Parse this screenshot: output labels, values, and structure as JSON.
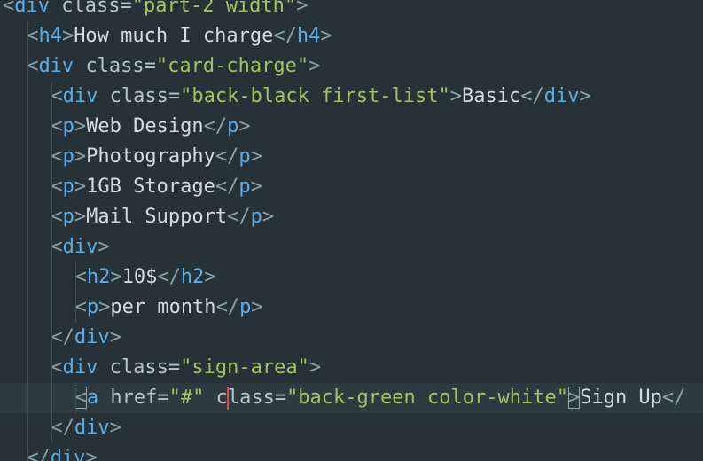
{
  "editor": {
    "lines": [
      {
        "indent": 0,
        "tokens": [
          {
            "t": "<",
            "c": "bracket"
          },
          {
            "t": "div",
            "c": "tag"
          },
          {
            "t": " ",
            "c": "text"
          },
          {
            "t": "class",
            "c": "attr"
          },
          {
            "t": "=",
            "c": "eq"
          },
          {
            "t": "\"part-2 width\"",
            "c": "str"
          },
          {
            "t": ">",
            "c": "bracket"
          }
        ]
      },
      {
        "indent": 1,
        "tokens": [
          {
            "t": "<",
            "c": "bracket"
          },
          {
            "t": "h4",
            "c": "tag"
          },
          {
            "t": ">",
            "c": "bracket"
          },
          {
            "t": "How much I charge",
            "c": "text"
          },
          {
            "t": "</",
            "c": "bracket"
          },
          {
            "t": "h4",
            "c": "tag"
          },
          {
            "t": ">",
            "c": "bracket"
          }
        ]
      },
      {
        "indent": 1,
        "tokens": [
          {
            "t": "<",
            "c": "bracket"
          },
          {
            "t": "div",
            "c": "tag"
          },
          {
            "t": " ",
            "c": "text"
          },
          {
            "t": "class",
            "c": "attr"
          },
          {
            "t": "=",
            "c": "eq"
          },
          {
            "t": "\"card-charge\"",
            "c": "str"
          },
          {
            "t": ">",
            "c": "bracket"
          }
        ]
      },
      {
        "indent": 2,
        "tokens": [
          {
            "t": "<",
            "c": "bracket"
          },
          {
            "t": "div",
            "c": "tag"
          },
          {
            "t": " ",
            "c": "text"
          },
          {
            "t": "class",
            "c": "attr"
          },
          {
            "t": "=",
            "c": "eq"
          },
          {
            "t": "\"back-black first-list\"",
            "c": "str"
          },
          {
            "t": ">",
            "c": "bracket"
          },
          {
            "t": "Basic",
            "c": "text"
          },
          {
            "t": "</",
            "c": "bracket"
          },
          {
            "t": "div",
            "c": "tag"
          },
          {
            "t": ">",
            "c": "bracket"
          }
        ]
      },
      {
        "indent": 2,
        "tokens": [
          {
            "t": "<",
            "c": "bracket"
          },
          {
            "t": "p",
            "c": "tag"
          },
          {
            "t": ">",
            "c": "bracket"
          },
          {
            "t": "Web Design",
            "c": "text"
          },
          {
            "t": "</",
            "c": "bracket"
          },
          {
            "t": "p",
            "c": "tag"
          },
          {
            "t": ">",
            "c": "bracket"
          }
        ]
      },
      {
        "indent": 2,
        "tokens": [
          {
            "t": "<",
            "c": "bracket"
          },
          {
            "t": "p",
            "c": "tag"
          },
          {
            "t": ">",
            "c": "bracket"
          },
          {
            "t": "Photography",
            "c": "text"
          },
          {
            "t": "</",
            "c": "bracket"
          },
          {
            "t": "p",
            "c": "tag"
          },
          {
            "t": ">",
            "c": "bracket"
          }
        ]
      },
      {
        "indent": 2,
        "tokens": [
          {
            "t": "<",
            "c": "bracket"
          },
          {
            "t": "p",
            "c": "tag"
          },
          {
            "t": ">",
            "c": "bracket"
          },
          {
            "t": "1GB Storage",
            "c": "text"
          },
          {
            "t": "</",
            "c": "bracket"
          },
          {
            "t": "p",
            "c": "tag"
          },
          {
            "t": ">",
            "c": "bracket"
          }
        ]
      },
      {
        "indent": 2,
        "tokens": [
          {
            "t": "<",
            "c": "bracket"
          },
          {
            "t": "p",
            "c": "tag"
          },
          {
            "t": ">",
            "c": "bracket"
          },
          {
            "t": "Mail Support",
            "c": "text"
          },
          {
            "t": "</",
            "c": "bracket"
          },
          {
            "t": "p",
            "c": "tag"
          },
          {
            "t": ">",
            "c": "bracket"
          }
        ]
      },
      {
        "indent": 2,
        "tokens": [
          {
            "t": "<",
            "c": "bracket"
          },
          {
            "t": "div",
            "c": "tag"
          },
          {
            "t": ">",
            "c": "bracket"
          }
        ]
      },
      {
        "indent": 3,
        "tokens": [
          {
            "t": "<",
            "c": "bracket"
          },
          {
            "t": "h2",
            "c": "tag"
          },
          {
            "t": ">",
            "c": "bracket"
          },
          {
            "t": "10$",
            "c": "text"
          },
          {
            "t": "</",
            "c": "bracket"
          },
          {
            "t": "h2",
            "c": "tag"
          },
          {
            "t": ">",
            "c": "bracket"
          }
        ]
      },
      {
        "indent": 3,
        "tokens": [
          {
            "t": "<",
            "c": "bracket"
          },
          {
            "t": "p",
            "c": "tag"
          },
          {
            "t": ">",
            "c": "bracket"
          },
          {
            "t": "per month",
            "c": "text"
          },
          {
            "t": "</",
            "c": "bracket"
          },
          {
            "t": "p",
            "c": "tag"
          },
          {
            "t": ">",
            "c": "bracket"
          }
        ]
      },
      {
        "indent": 2,
        "tokens": [
          {
            "t": "</",
            "c": "bracket"
          },
          {
            "t": "div",
            "c": "tag"
          },
          {
            "t": ">",
            "c": "bracket"
          }
        ]
      },
      {
        "indent": 2,
        "tokens": [
          {
            "t": "<",
            "c": "bracket"
          },
          {
            "t": "div",
            "c": "tag"
          },
          {
            "t": " ",
            "c": "text"
          },
          {
            "t": "class",
            "c": "attr"
          },
          {
            "t": "=",
            "c": "eq"
          },
          {
            "t": "\"sign-area\"",
            "c": "str"
          },
          {
            "t": ">",
            "c": "bracket"
          }
        ]
      },
      {
        "indent": 3,
        "active": true,
        "tokens": [
          {
            "t": "<",
            "c": "bracket",
            "match": true
          },
          {
            "t": "a",
            "c": "tag"
          },
          {
            "t": " ",
            "c": "text"
          },
          {
            "t": "href",
            "c": "attr"
          },
          {
            "t": "=",
            "c": "eq"
          },
          {
            "t": "\"#\"",
            "c": "str"
          },
          {
            "t": " ",
            "c": "text"
          },
          {
            "t": "c",
            "c": "attr"
          },
          {
            "cursor": true
          },
          {
            "t": "lass",
            "c": "attr"
          },
          {
            "t": "=",
            "c": "eq"
          },
          {
            "t": "\"back-green color-white\"",
            "c": "str"
          },
          {
            "t": ">",
            "c": "bracket",
            "match": true
          },
          {
            "t": "Sign Up",
            "c": "text"
          },
          {
            "t": "</",
            "c": "bracket"
          }
        ]
      },
      {
        "indent": 2,
        "tokens": [
          {
            "t": "</",
            "c": "bracket"
          },
          {
            "t": "div",
            "c": "tag"
          },
          {
            "t": ">",
            "c": "bracket"
          }
        ]
      },
      {
        "indent": 1,
        "tokens": [
          {
            "t": "</",
            "c": "bracket"
          },
          {
            "t": "div",
            "c": "tag"
          },
          {
            "t": ">",
            "c": "bracket"
          }
        ]
      }
    ]
  },
  "colors": {
    "background": "#263238",
    "active_line": "#2d3b41",
    "tag": "#5aaee8",
    "string": "#a5c261",
    "text": "#d5dade",
    "cursor": "#e5484d"
  }
}
